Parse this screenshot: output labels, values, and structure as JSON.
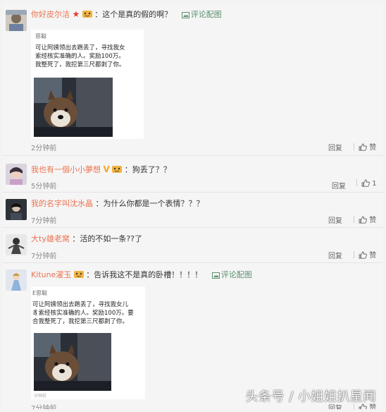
{
  "comments": [
    {
      "username": "你好皮尔洁",
      "badge": "★",
      "text": "：这个是真的假的啊？",
      "pic_link": "评论配图",
      "time": "2分钟前",
      "reply": "回复",
      "like": "赞",
      "card": {
        "poster": "思聪",
        "lines": [
          "可让阿姨领出去跑丢了，寻找我女",
          "索经核实准确的人。奖励100万。",
          "我整死了，我挖第三尺都剥了你。"
        ],
        "time": ""
      }
    },
    {
      "username": "我也有一個小小夢想",
      "badge": "V",
      "text": "：狗丢了？？",
      "time": "5分钟前",
      "reply": "回复",
      "like": "1"
    },
    {
      "username": "我的名字叫沈水晶",
      "text": "：为什么你都是一个表情？？？",
      "time": "7分钟前",
      "reply": "回复",
      "like": "赞"
    },
    {
      "username": "大ty雄老窝",
      "text": "：活的不如一条??了",
      "time": "7分钟前",
      "reply": "回复",
      "like": "赞"
    },
    {
      "username": "Kitune濯玉",
      "text": "：告诉我这不是真的卧槽！！！！",
      "pic_link": "评论配图",
      "time": "7分钟前",
      "reply": "回复",
      "like": "赞",
      "card": {
        "poster": "E思聪",
        "lines": [
          "可让阿姨领出去跑丢了，寻找我女儿",
          "豸索经核实准确的人。奖励100万。要",
          "合我整死了，我挖第三尺都剥了你。"
        ],
        "time": "分钟前"
      }
    }
  ],
  "watermark": "头条号 / 小姐姐扒星闻",
  "colors": {
    "username": "#eb7350",
    "pic_link": "#5a8f6e",
    "background": "#f5f5f5"
  }
}
